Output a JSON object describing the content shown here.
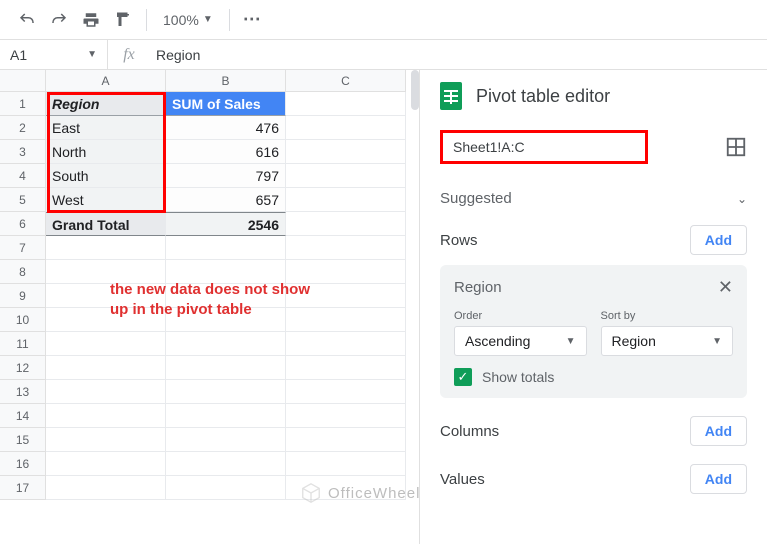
{
  "toolbar": {
    "zoom": "100%"
  },
  "fx": {
    "namebox": "A1",
    "formula": "Region"
  },
  "grid": {
    "col_headers": [
      "A",
      "B",
      "C"
    ],
    "row_numbers": [
      "1",
      "2",
      "3",
      "4",
      "5",
      "6",
      "7",
      "8",
      "9",
      "10",
      "11",
      "12",
      "13",
      "14",
      "15",
      "16",
      "17"
    ],
    "pivot": {
      "header_a": "Region",
      "header_b": "SUM of Sales",
      "rows": [
        {
          "a": "East",
          "b": "476"
        },
        {
          "a": "North",
          "b": "616"
        },
        {
          "a": "South",
          "b": "797"
        },
        {
          "a": "West",
          "b": "657"
        }
      ],
      "total_a": "Grand Total",
      "total_b": "2546"
    }
  },
  "annotation": "the new data does not show up in the pivot table",
  "watermark": "OfficeWheel",
  "editor": {
    "title": "Pivot table editor",
    "range": "Sheet1!A:C",
    "suggested_label": "Suggested",
    "rows_label": "Rows",
    "columns_label": "Columns",
    "values_label": "Values",
    "add_label": "Add",
    "chip": {
      "title": "Region",
      "order_label": "Order",
      "order_value": "Ascending",
      "sortby_label": "Sort by",
      "sortby_value": "Region",
      "show_totals_label": "Show totals"
    }
  }
}
